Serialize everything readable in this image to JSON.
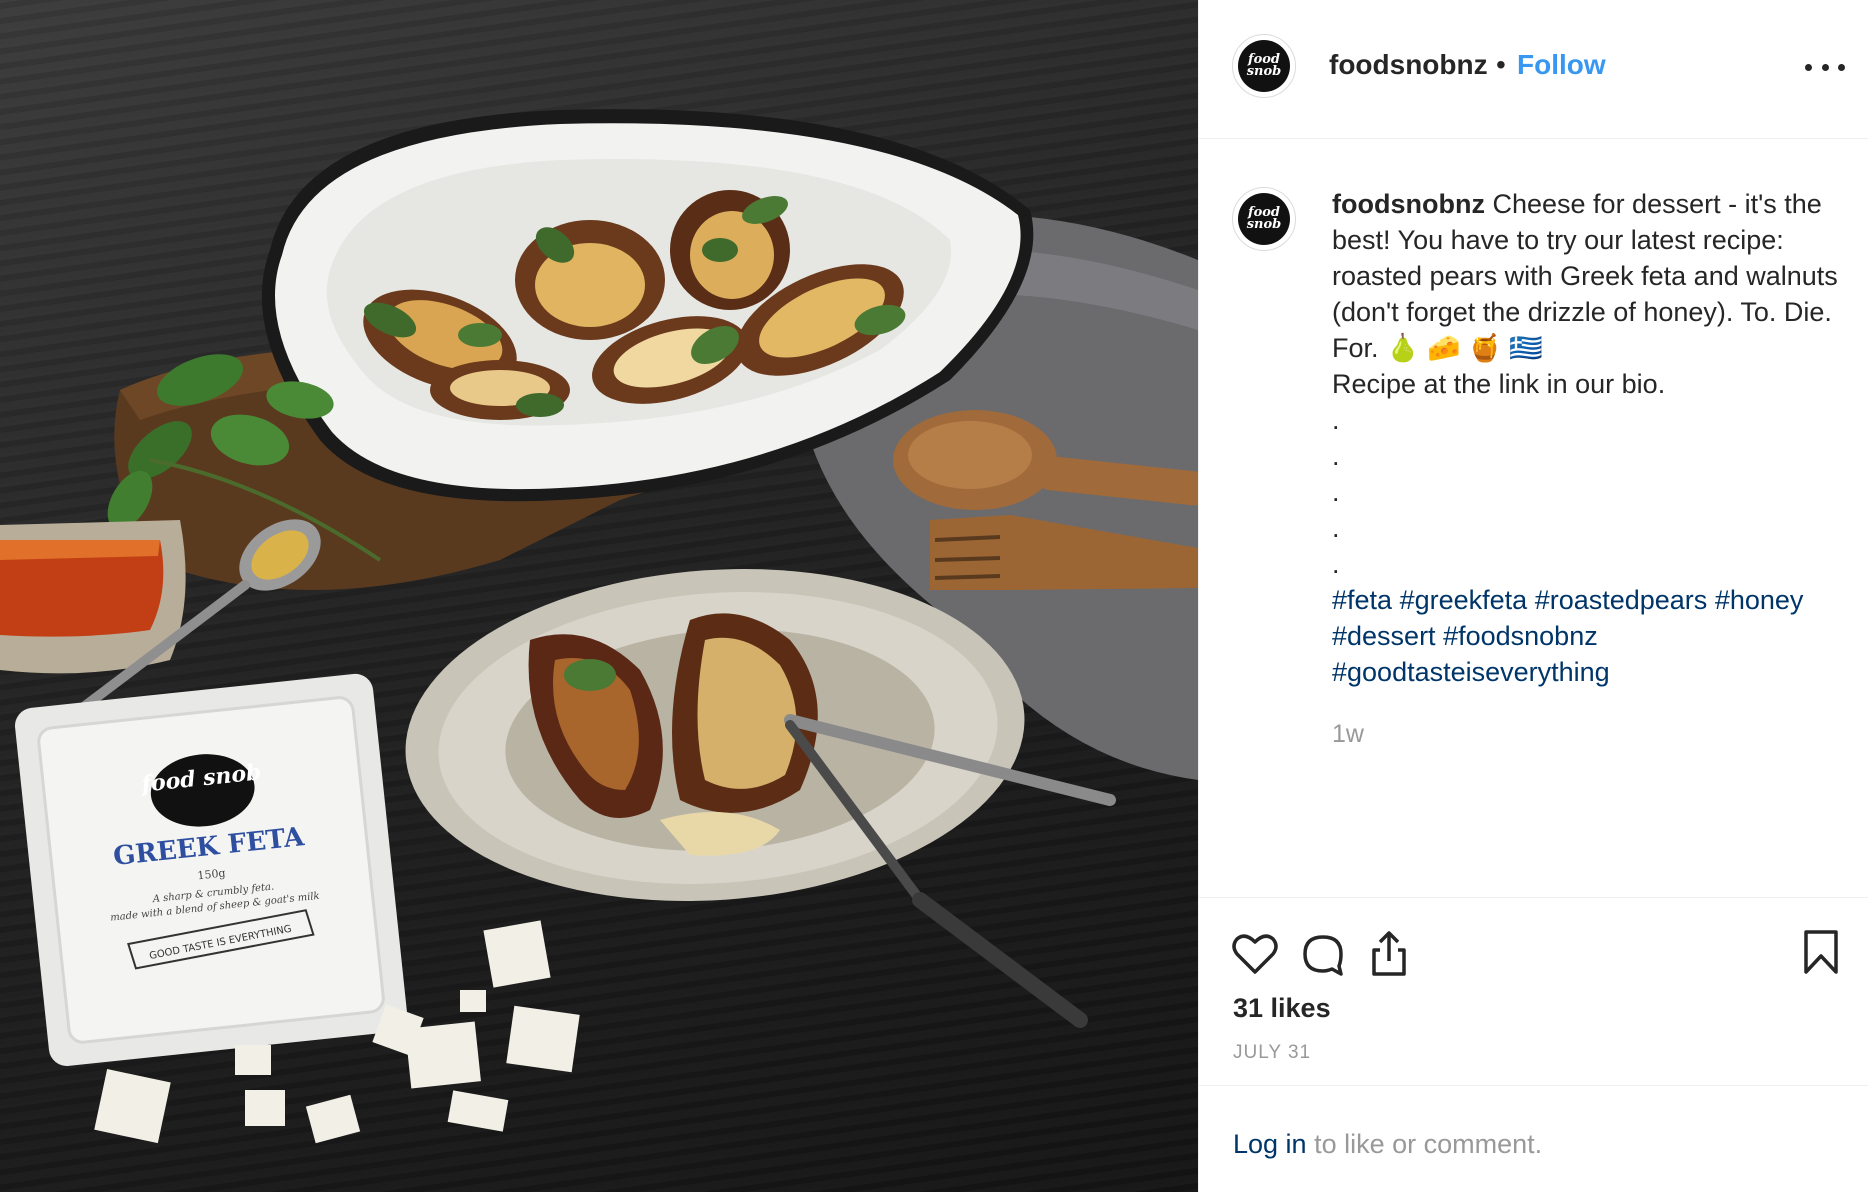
{
  "post": {
    "username": "foodsnobnz",
    "separator": "•",
    "follow_label": "Follow",
    "avatar_text": "food snob"
  },
  "caption": {
    "username": "foodsnobnz",
    "text": "Cheese for dessert - it's the best! You have to try our latest recipe: roasted pears with Greek feta and walnuts (don't forget the drizzle of honey). To. Die. For. 🍐 🧀 🍯 🇬🇷",
    "line2": "Recipe at the link in our bio.",
    "dots": [
      ".",
      ".",
      ".",
      ".",
      "."
    ],
    "hashtags": [
      "#feta",
      "#greekfeta",
      "#roastedpears",
      "#honey",
      "#dessert",
      "#foodsnobnz",
      "#goodtasteiseverything"
    ],
    "time_ago": "1w"
  },
  "stats": {
    "likes": "31 likes",
    "date": "JULY 31"
  },
  "login": {
    "link": "Log in",
    "rest": " to like or comment."
  },
  "photo": {
    "package_brand": "food snob",
    "package_title": "GREEK FETA",
    "package_weight": "150g",
    "package_desc1": "A sharp & crumbly feta.",
    "package_desc2": "made with a blend of sheep & goat's milk",
    "package_banner": "GOOD TASTE IS EVERYTHING"
  },
  "colors": {
    "follow_blue": "#3897f0",
    "hashtag_blue": "#003569",
    "muted_gray": "#999999",
    "text_dark": "#262626"
  },
  "icons": [
    "heart-icon",
    "comment-icon",
    "share-icon",
    "bookmark-icon",
    "more-options-icon"
  ]
}
